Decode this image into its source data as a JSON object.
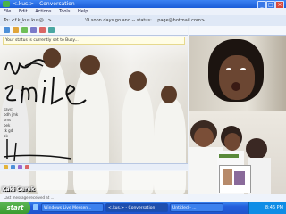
{
  "window": {
    "title": "<.kus.> - Conversation",
    "controls": [
      "_",
      "□",
      "×"
    ]
  },
  "menu": [
    "File",
    "Edit",
    "Actions",
    "Tools",
    "Help"
  ],
  "conversation_bar": {
    "left": "To: <f.k_kus.kus@...>",
    "right": "'O soon days go and -- status: ...page@hotmail.com>"
  },
  "chat": {
    "notice": "Your status is currently set to Busy...",
    "lines": [
      "says:",
      "bdh jmk",
      "sms",
      "bek",
      "tk gd",
      "ok"
    ]
  },
  "overlay": {
    "scribble_words": [
      "smile",
      "ri"
    ],
    "signature": "Kaki Gerek"
  },
  "status_text": "Last message received at ...",
  "taskbar": {
    "start_label": "start",
    "tasks": [
      {
        "label": "Windows Live Messen...",
        "active": false
      },
      {
        "label": "<.kus.> - Conversation",
        "active": true
      },
      {
        "label": "Untitled - ...",
        "active": false
      }
    ],
    "clock": "8:46 PM"
  },
  "colors": {
    "titlebar": "#1b5dd8",
    "taskbar": "#245edb",
    "start": "#3a9b2f"
  }
}
